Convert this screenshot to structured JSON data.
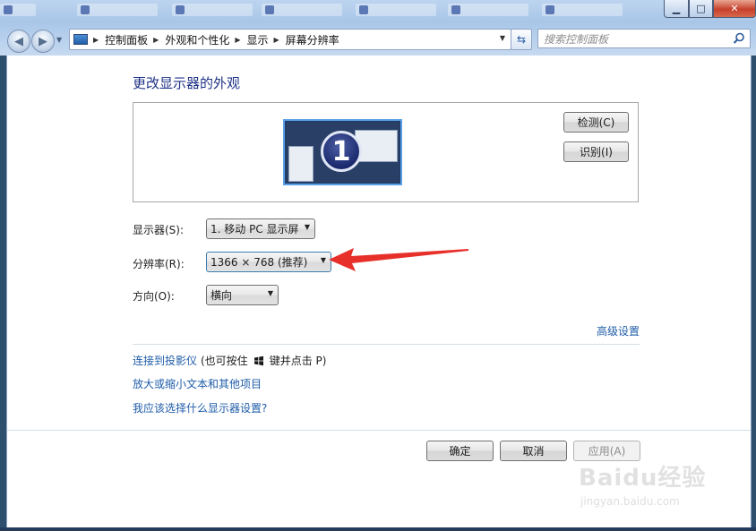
{
  "breadcrumb": [
    "控制面板",
    "外观和个性化",
    "显示",
    "屏幕分辨率"
  ],
  "search": {
    "placeholder": "搜索控制面板"
  },
  "page": {
    "title": "更改显示器的外观"
  },
  "preview": {
    "monitor_number": "1"
  },
  "buttons": {
    "detect": "检测(C)",
    "identify": "识别(I)",
    "ok": "确定",
    "cancel": "取消",
    "apply": "应用(A)"
  },
  "settings": {
    "display_label": "显示器(S):",
    "display_value": "1. 移动 PC 显示屏",
    "resolution_label": "分辨率(R):",
    "resolution_value": "1366 × 768 (推荐)",
    "orientation_label": "方向(O):",
    "orientation_value": "横向"
  },
  "links": {
    "advanced": "高级设置",
    "projector": "连接到投影仪",
    "projector_hint_before": "(也可按住",
    "projector_hint_after": "键并点击 P)",
    "text_size": "放大或缩小文本和其他项目",
    "which_settings": "我应该选择什么显示器设置?"
  },
  "colors": {
    "link": "#1f5ca8",
    "title": "#1e3287",
    "annotation_arrow": "#e8302b"
  },
  "watermark": {
    "logo": "Baidu经验",
    "url": "jingyan.baidu.com"
  }
}
